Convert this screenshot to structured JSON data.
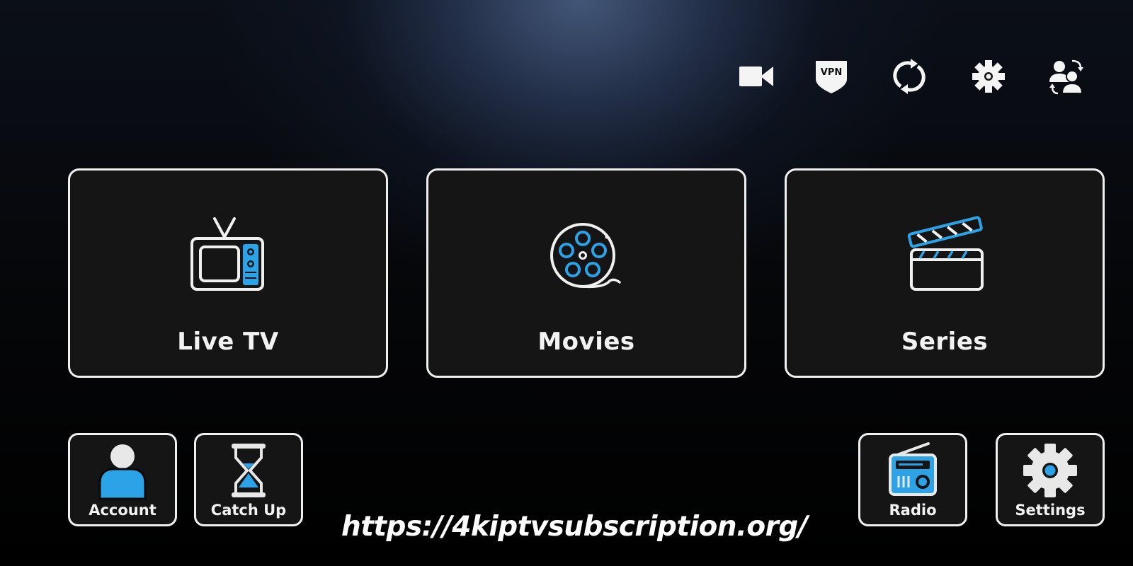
{
  "colors": {
    "accent": "#2ba3e6",
    "foreground": "#f0f0f0",
    "card_bg": "#151515",
    "background": "#000000"
  },
  "topbar": {
    "icons": [
      {
        "name": "record-video-icon",
        "label": ""
      },
      {
        "name": "vpn-shield-icon",
        "label": "VPN"
      },
      {
        "name": "refresh-icon",
        "label": ""
      },
      {
        "name": "settings-gear-icon",
        "label": ""
      },
      {
        "name": "switch-user-icon",
        "label": ""
      }
    ]
  },
  "main_tiles": [
    {
      "label": "Live TV",
      "icon": "tv-icon"
    },
    {
      "label": "Movies",
      "icon": "film-reel-icon"
    },
    {
      "label": "Series",
      "icon": "clapperboard-icon"
    }
  ],
  "small_tiles": [
    {
      "label": "Account",
      "icon": "user-icon"
    },
    {
      "label": "Catch Up",
      "icon": "hourglass-icon"
    },
    {
      "label": "Radio",
      "icon": "radio-icon"
    },
    {
      "label": "Settings",
      "icon": "gear-icon"
    }
  ],
  "footer": {
    "url": "https://4kiptvsubscription.org/"
  }
}
